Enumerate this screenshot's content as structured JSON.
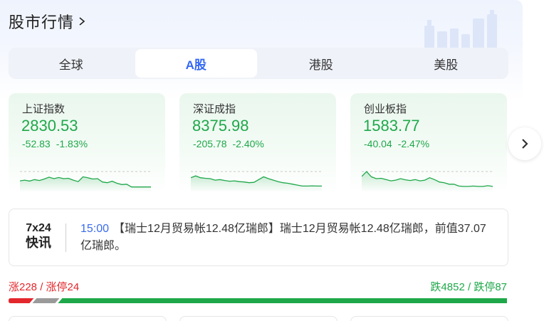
{
  "header": {
    "title": "股市行情"
  },
  "tabs": [
    {
      "label": "全球",
      "active": false
    },
    {
      "label": "A股",
      "active": true
    },
    {
      "label": "港股",
      "active": false
    },
    {
      "label": "美股",
      "active": false
    }
  ],
  "indices": [
    {
      "name": "上证指数",
      "value": "2830.53",
      "change": "-52.83",
      "percent": "-1.83%",
      "trend": [
        0.62,
        0.58,
        0.63,
        0.55,
        0.6,
        0.52,
        0.42,
        0.5,
        0.44,
        0.5,
        0.48,
        0.58,
        0.66,
        0.4,
        0.45,
        0.52,
        0.5,
        0.68,
        0.72,
        0.64,
        0.75,
        0.82,
        0.8,
        0.95,
        0.95,
        0.95,
        0.95,
        0.95
      ]
    },
    {
      "name": "深证成指",
      "value": "8375.98",
      "change": "-205.78",
      "percent": "-2.40%",
      "trend": [
        0.45,
        0.35,
        0.45,
        0.48,
        0.5,
        0.58,
        0.55,
        0.6,
        0.64,
        0.62,
        0.66,
        0.68,
        0.72,
        0.7,
        0.55,
        0.4,
        0.5,
        0.58,
        0.66,
        0.72,
        0.75,
        0.8,
        0.85,
        0.9,
        0.9,
        0.89,
        0.9,
        0.9
      ]
    },
    {
      "name": "创业板指",
      "value": "1583.77",
      "change": "-40.04",
      "percent": "-2.47%",
      "trend": [
        0.38,
        0.12,
        0.4,
        0.5,
        0.48,
        0.55,
        0.62,
        0.58,
        0.5,
        0.56,
        0.6,
        0.55,
        0.62,
        0.58,
        0.45,
        0.55,
        0.68,
        0.72,
        0.8,
        0.8,
        0.9,
        0.92,
        0.92,
        0.9,
        0.92,
        0.92,
        0.88,
        0.92
      ]
    }
  ],
  "news": {
    "brand_line1": "7x24",
    "brand_line2": "快讯",
    "time": "15:00",
    "text": "【瑞士12月贸易帐12.48亿瑞郎】瑞士12月贸易帐12.48亿瑞郎，前值37.07亿瑞郎。"
  },
  "stats": {
    "rise": "涨228",
    "limit_up": "涨停24",
    "fall": "跌4852",
    "limit_down": "跌停87"
  },
  "breadth": {
    "rise": 228,
    "limit_up": 24,
    "fall": 4852,
    "limit_down": 87
  },
  "colors": {
    "up": "#e3272c",
    "down": "#1fa84a",
    "flat": "#9a9a9a",
    "accent": "#3368f5"
  }
}
